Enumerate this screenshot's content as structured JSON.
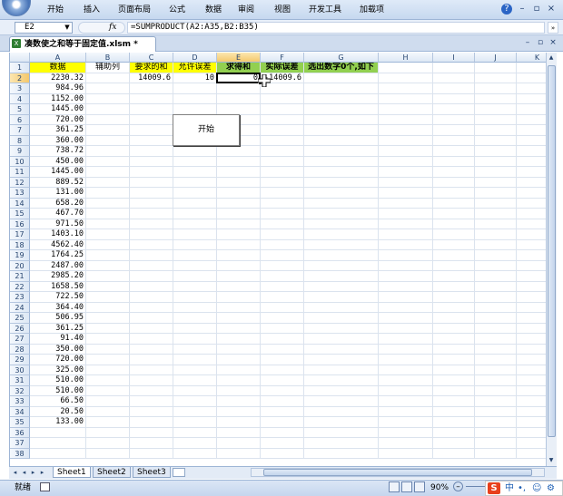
{
  "ribbon": {
    "tabs": [
      "开始",
      "插入",
      "页面布局",
      "公式",
      "数据",
      "审阅",
      "视图",
      "开发工具",
      "加载项"
    ]
  },
  "window_controls": {
    "help": "?",
    "minimize": "–",
    "restore": "▫",
    "close": "×"
  },
  "formula_bar": {
    "name_box": "E2",
    "fx": "fx",
    "formula": "=SUMPRODUCT(A2:A35,B2:B35)",
    "expand": "»"
  },
  "document": {
    "tab_title": "凑数使之和等于固定值.xlsm *",
    "icon": "excel-file-icon"
  },
  "columns": [
    "A",
    "B",
    "C",
    "D",
    "E",
    "F",
    "G",
    "H",
    "I",
    "J",
    "K"
  ],
  "selected_column": "E",
  "selected_row": 2,
  "header_row": {
    "A": "数据",
    "B": "辅助列",
    "C": "要求的和",
    "D": "允许误差",
    "E": "求得和",
    "F": "实际误差",
    "G": "选出数字0个,如下"
  },
  "row2": {
    "C": "14009.6",
    "D": "10",
    "E": "0",
    "F": "-14009.6"
  },
  "data_values": [
    "2230.32",
    "984.96",
    "1152.00",
    "1445.00",
    "720.00",
    "361.25",
    "360.00",
    "738.72",
    "450.00",
    "1445.00",
    "889.52",
    "131.00",
    "658.20",
    "467.70",
    "971.50",
    "1403.10",
    "4562.40",
    "1764.25",
    "2487.00",
    "2985.20",
    "1658.50",
    "722.50",
    "364.40",
    "506.95",
    "361.25",
    "91.40",
    "350.00",
    "720.00",
    "325.00",
    "510.00",
    "510.00",
    "66.50",
    "20.50",
    "133.00"
  ],
  "total_rows": 38,
  "start_button": {
    "label": "开始"
  },
  "sheets": [
    "Sheet1",
    "Sheet2",
    "Sheet3"
  ],
  "active_sheet": "Sheet1",
  "status": {
    "ready": "就绪",
    "zoom": "90%"
  },
  "ime": {
    "logo": "S",
    "mode": "中"
  },
  "colors": {
    "yellow_header": "#ffff00",
    "green_header": "#92d050",
    "selection": "#f4c86c"
  }
}
